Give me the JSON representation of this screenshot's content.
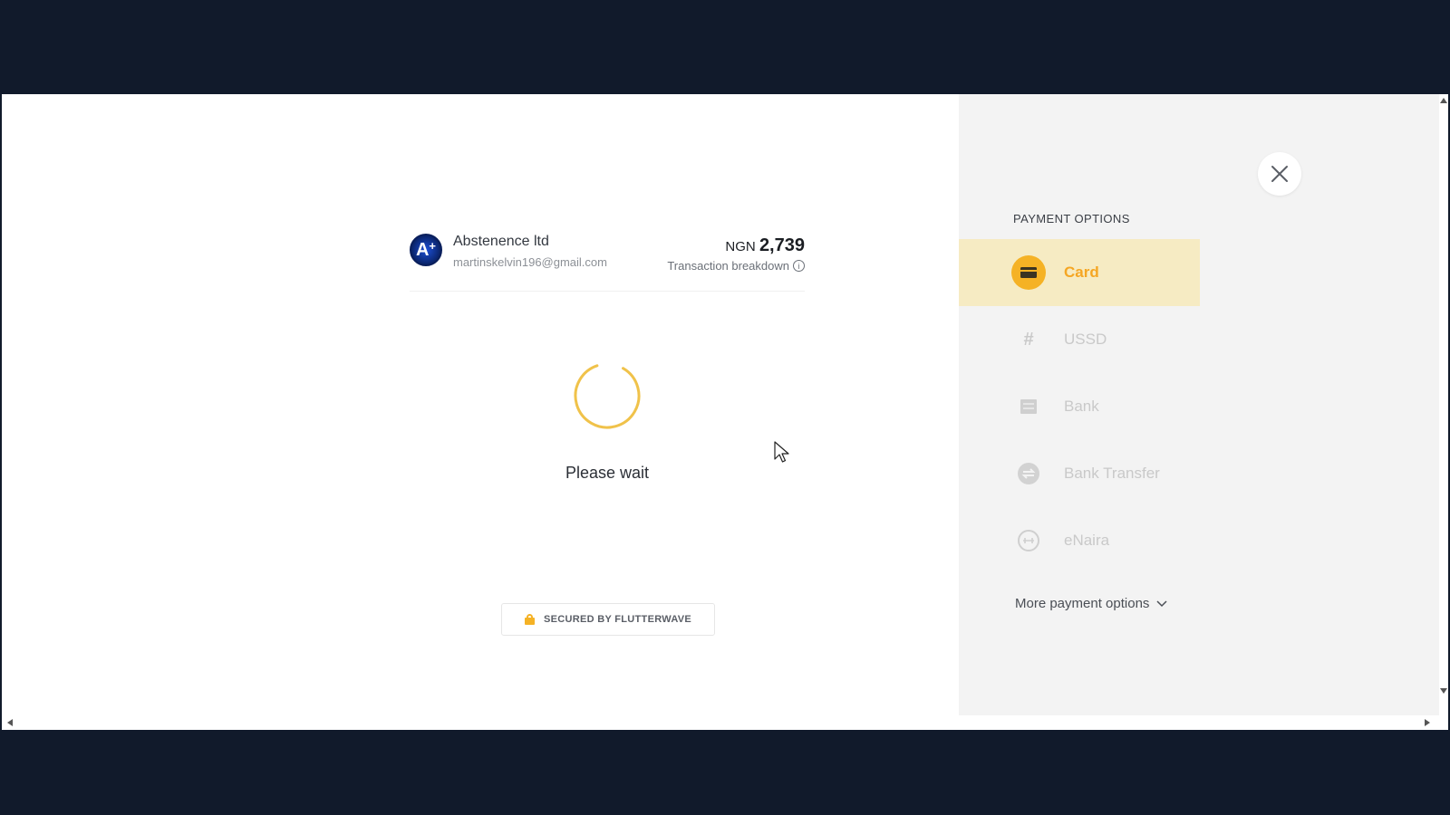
{
  "merchant": {
    "avatar_letter": "A",
    "avatar_plus": "+",
    "name": "Abstenence ltd",
    "email": "martinskelvin196@gmail.com"
  },
  "amount": {
    "currency": "NGN",
    "value": "2,739",
    "breakdown_label": "Transaction breakdown",
    "info_icon": "i"
  },
  "status": {
    "message": "Please wait"
  },
  "secured_badge": {
    "label": "SECURED BY FLUTTERWAVE"
  },
  "payment_options": {
    "title": "PAYMENT OPTIONS",
    "items": [
      {
        "label": "Card",
        "icon": "card-icon",
        "active": true
      },
      {
        "label": "USSD",
        "icon": "hash-icon",
        "active": false
      },
      {
        "label": "Bank",
        "icon": "bank-icon",
        "active": false
      },
      {
        "label": "Bank Transfer",
        "icon": "transfer-icon",
        "active": false
      },
      {
        "label": "eNaira",
        "icon": "enaira-icon",
        "active": false
      }
    ],
    "more_label": "More payment options"
  },
  "colors": {
    "accent": "#f5a623",
    "active_bg": "#f6ebc3",
    "page_bg": "#111a2b"
  }
}
